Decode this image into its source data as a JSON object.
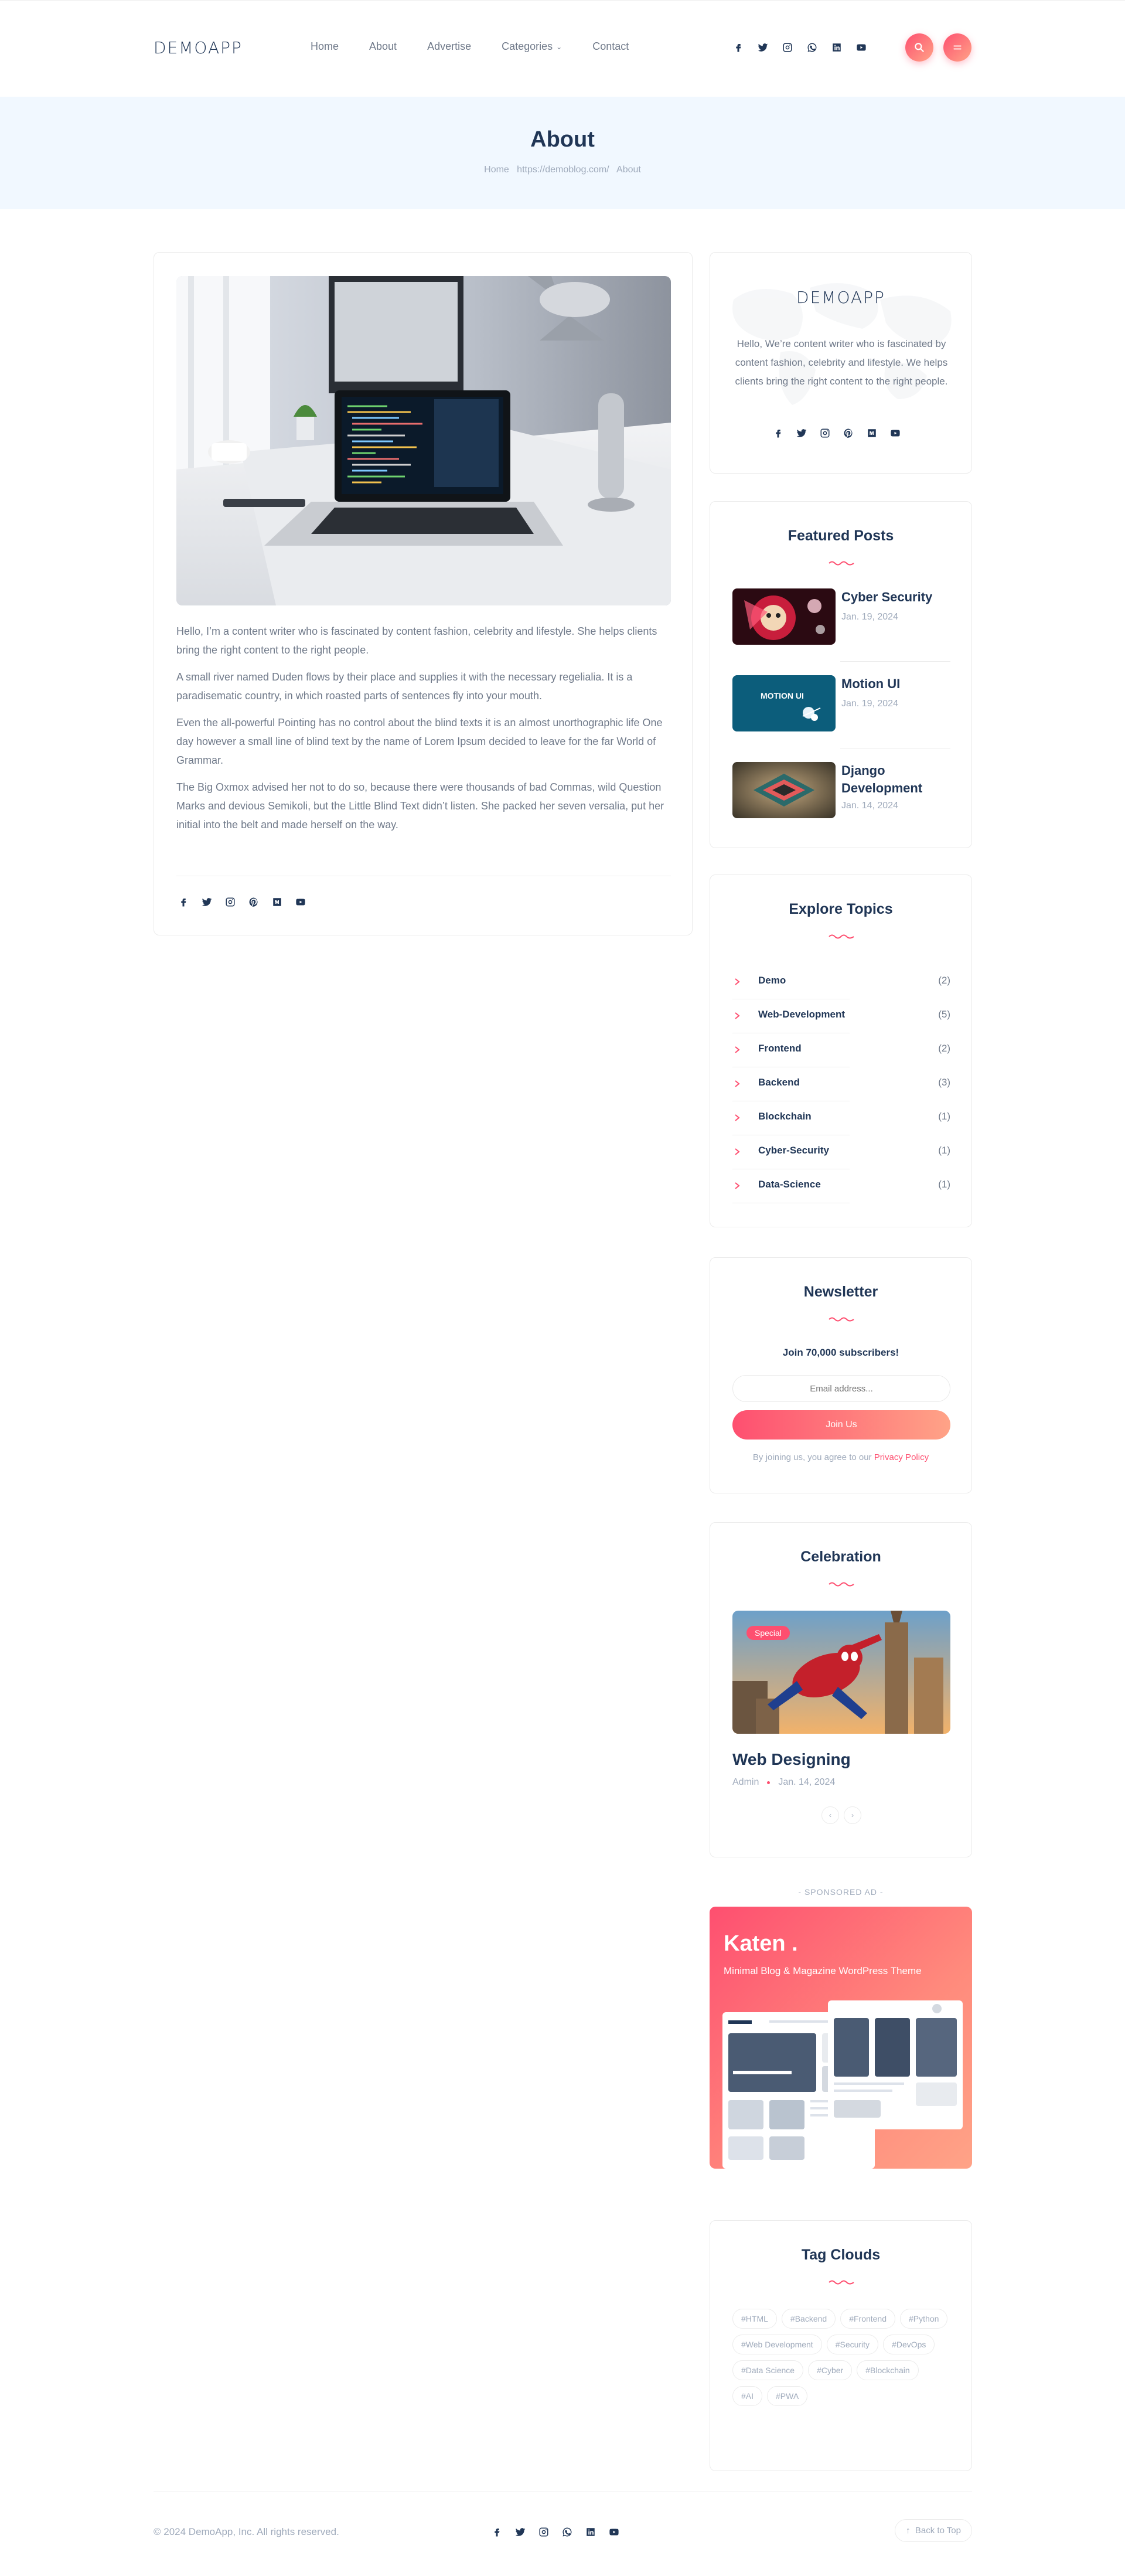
{
  "header": {
    "logo": "DEMOAPP",
    "nav": [
      {
        "label": "Home"
      },
      {
        "label": "About"
      },
      {
        "label": "Advertise"
      },
      {
        "label": "Categories"
      },
      {
        "label": "Contact"
      }
    ],
    "social_icons": [
      "facebook-icon",
      "twitter-icon",
      "instagram-icon",
      "whatsapp-icon",
      "linkedin-icon",
      "youtube-icon"
    ]
  },
  "banner": {
    "title": "About",
    "breadcrumb": {
      "home": "Home",
      "url": "https://demoblog.com/",
      "current": "About"
    }
  },
  "article": {
    "paragraphs": [
      "Hello, I’m a content writer who is fascinated by content fashion, celebrity and lifestyle. She helps clients bring the right content to the right people.",
      "A small river named Duden flows by their place and supplies it with the necessary regelialia. It is a paradisematic country, in which roasted parts of sentences fly into your mouth.",
      "Even the all-powerful Pointing has no control about the blind texts it is an almost unorthographic life One day however a small line of blind text by the name of Lorem Ipsum decided to leave for the far World of Grammar.",
      "The Big Oxmox advised her not to do so, because there were thousands of bad Commas, wild Question Marks and devious Semikoli, but the Little Blind Text didn’t listen. She packed her seven versalia, put her initial into the belt and made herself on the way."
    ],
    "social_icons": [
      "facebook-icon",
      "twitter-icon",
      "instagram-icon",
      "pinterest-icon",
      "medium-icon",
      "youtube-icon"
    ]
  },
  "sidebar": {
    "about": {
      "logo": "DEMOAPP",
      "text": "Hello, We’re content writer who is fascinated by content fashion, celebrity and lifestyle. We helps clients bring the right content to the right people.",
      "social_icons": [
        "facebook-icon",
        "twitter-icon",
        "instagram-icon",
        "pinterest-icon",
        "medium-icon",
        "youtube-icon"
      ]
    },
    "featured": {
      "title": "Featured Posts",
      "posts": [
        {
          "title": "Cyber Security",
          "date": "Jan. 19, 2024"
        },
        {
          "title": "Motion UI",
          "date": "Jan. 19, 2024",
          "thumb_text": "MOTION UI"
        },
        {
          "title": "Django Development",
          "date": "Jan. 14, 2024"
        }
      ]
    },
    "topics": {
      "title": "Explore Topics",
      "items": [
        {
          "name": "Demo",
          "count": "(2)"
        },
        {
          "name": "Web-Development",
          "count": "(5)"
        },
        {
          "name": "Frontend",
          "count": "(2)"
        },
        {
          "name": "Backend",
          "count": "(3)"
        },
        {
          "name": "Blockchain",
          "count": "(1)"
        },
        {
          "name": "Cyber-Security",
          "count": "(1)"
        },
        {
          "name": "Data-Science",
          "count": "(1)"
        }
      ]
    },
    "newsletter": {
      "title": "Newsletter",
      "subtitle": "Join 70,000 subscribers!",
      "placeholder": "Email address...",
      "button": "Join Us",
      "note": "By joining us, you agree to our",
      "note_link": "Privacy Policy"
    },
    "celebration": {
      "title": "Celebration",
      "badge": "Special",
      "post_title": "Web Designing",
      "author": "Admin",
      "date": "Jan. 14, 2024"
    },
    "ad": {
      "label": "- SPONSORED AD -",
      "brand": "Katen",
      "tagline": "Minimal Blog & Magazine WordPress Theme"
    },
    "tags": {
      "title": "Tag Clouds",
      "items": [
        "#HTML",
        "#Backend",
        "#Frontend",
        "#Python",
        "#Web Development",
        "#Security",
        "#DevOps",
        "#Data Science",
        "#Cyber",
        "#Blockchain",
        "#AI",
        "#PWA"
      ]
    }
  },
  "footer": {
    "copyright": "© 2024 DemoApp, Inc. All rights reserved.",
    "back_to_top": "Back to Top",
    "social_icons": [
      "facebook-icon",
      "twitter-icon",
      "instagram-icon",
      "whatsapp-icon",
      "linkedin-icon",
      "youtube-icon"
    ]
  },
  "colors": {
    "accent": "#fe4f70",
    "accent_light": "#ffa387",
    "heading": "#203656",
    "text": "#707a8a",
    "banner_bg": "#f1f8ff"
  }
}
